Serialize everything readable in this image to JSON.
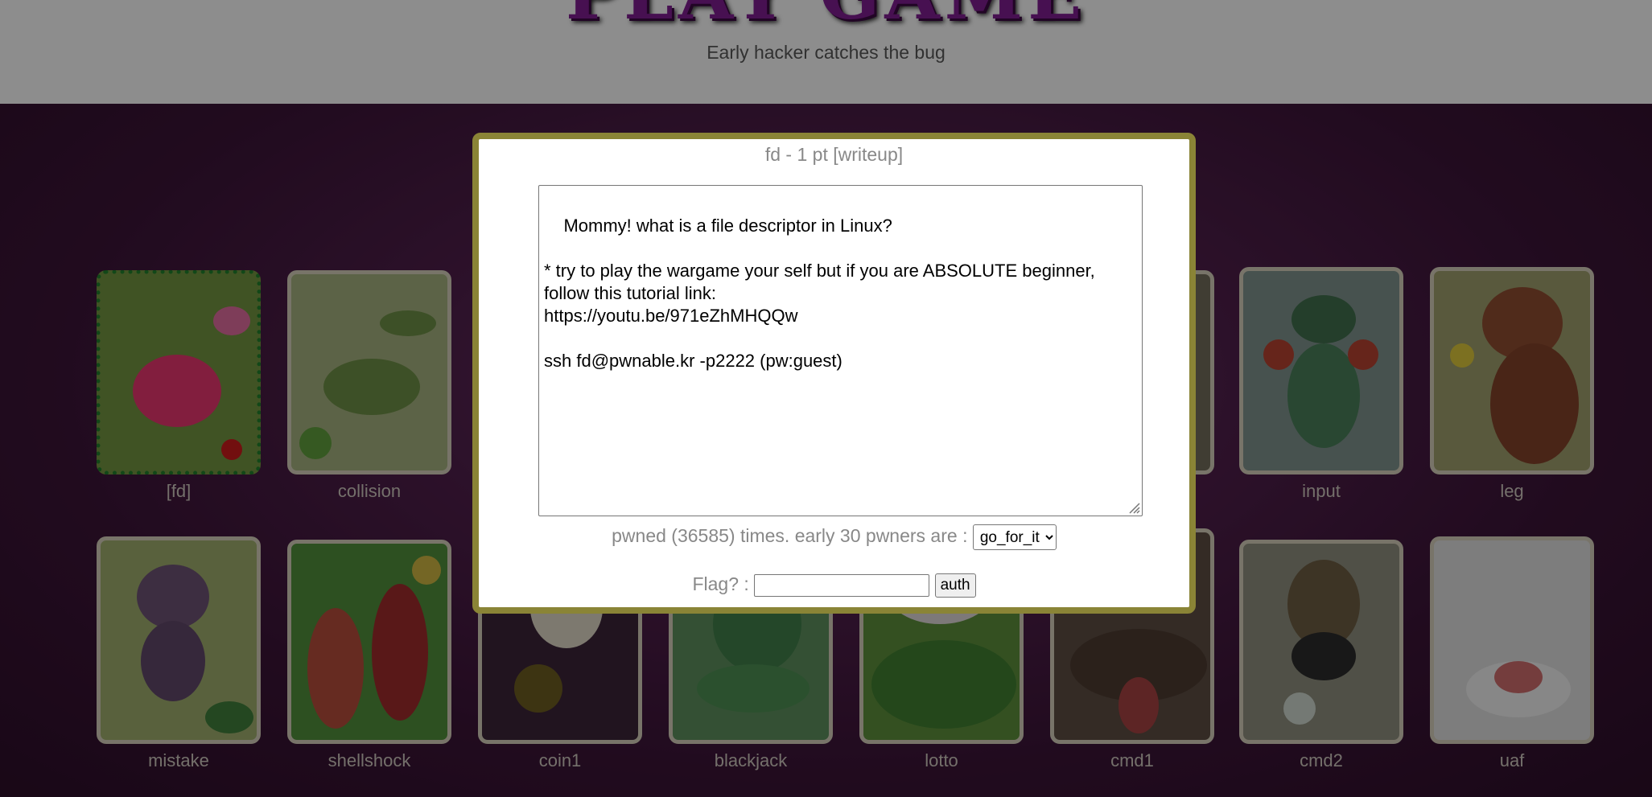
{
  "header": {
    "title": "PLAY GAME",
    "subtitle": "Early hacker catches the bug"
  },
  "challenges": [
    {
      "name": "[fd]",
      "art": "pink-slime-icon"
    },
    {
      "name": "collision",
      "art": "sea-cucumber-icon"
    },
    {
      "name": "",
      "art": "card-art"
    },
    {
      "name": "",
      "art": "card-art"
    },
    {
      "name": "",
      "art": "card-art"
    },
    {
      "name": "",
      "art": "card-art"
    },
    {
      "name": "input",
      "art": "boxing-bug-icon"
    },
    {
      "name": "leg",
      "art": "bear-icon"
    },
    {
      "name": "mistake",
      "art": "monkey-icon"
    },
    {
      "name": "shellshock",
      "art": "shell-creature-icon"
    },
    {
      "name": "coin1",
      "art": "ghost-icon"
    },
    {
      "name": "blackjack",
      "art": "frog-icon"
    },
    {
      "name": "lotto",
      "art": "hedgehog-icon"
    },
    {
      "name": "cmd1",
      "art": "mushroom-icon"
    },
    {
      "name": "cmd2",
      "art": "hermit-crab-icon"
    },
    {
      "name": "uaf",
      "art": "cloud-slime-icon"
    }
  ],
  "modal": {
    "title": "fd - 1 pt [writeup]",
    "description": "Mommy! what is a file descriptor in Linux?\n\n* try to play the wargame your self but if you are ABSOLUTE beginner, follow this tutorial link:\nhttps://youtu.be/971eZhMHQQw\n\nssh fd@pwnable.kr -p2222 (pw:guest)",
    "pwned_text": "pwned (36585) times. early 30 pwners are :",
    "pwners_selected": "go_for_it",
    "flag_label": "Flag? :",
    "flag_value": "",
    "auth_label": "auth"
  },
  "colors": {
    "header_bg": "#f3f3f3",
    "page_bg": "#4d1e49",
    "modal_border": "#8a8436",
    "selected_border": "#1f7a2a"
  }
}
